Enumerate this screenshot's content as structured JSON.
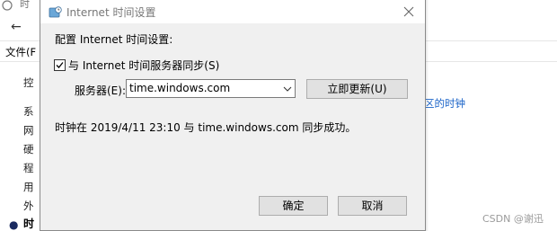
{
  "background": {
    "top_fragment": "时",
    "back_arrow": "←",
    "file_menu": "文件(F",
    "sidebar_chars": [
      "控",
      "系",
      "网",
      "硬",
      "程",
      "用",
      "外"
    ],
    "link_fragment": "区的时钟",
    "bold_fragment": "时",
    "watermark": "CSDN @谢迅"
  },
  "dialog": {
    "title": "Internet 时间设置",
    "close_glyph": "✕",
    "heading": "配置 Internet 时间设置:",
    "sync_checkbox": {
      "label": "与 Internet 时间服务器同步(S)",
      "checked": true
    },
    "server": {
      "label": "服务器(E):",
      "value": "time.windows.com"
    },
    "update_button": "立即更新(U)",
    "status_message": "时钟在 2019/4/11 23:10 与 time.windows.com 同步成功。",
    "ok_button": "确定",
    "cancel_button": "取消"
  },
  "colors": {
    "dialog_bg": "#f0f0f0",
    "button_bg": "#e1e1e1",
    "link": "#1a63c8"
  },
  "icons": {
    "title_icon": "clock-globe-icon",
    "combo_arrow": "chevron-down-icon",
    "close": "close-icon"
  }
}
